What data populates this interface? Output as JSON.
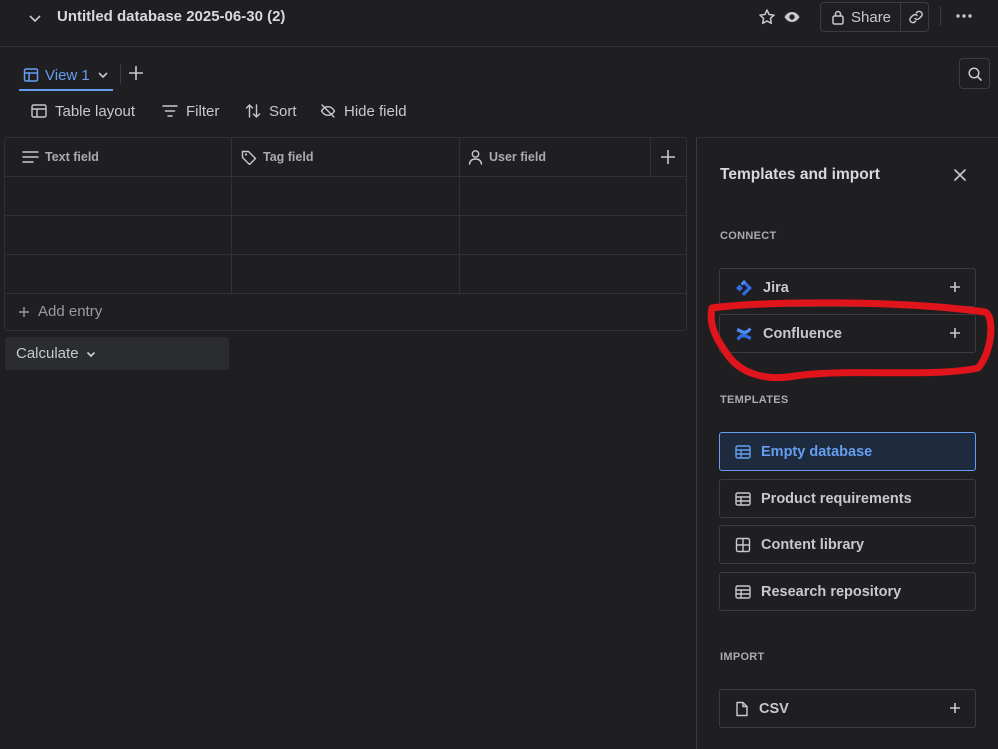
{
  "header": {
    "title": "Untitled database 2025-06-30 (2)",
    "share_label": "Share"
  },
  "views": {
    "active_label": "View 1"
  },
  "toolbar": {
    "layout_label": "Table layout",
    "filter_label": "Filter",
    "sort_label": "Sort",
    "hide_label": "Hide field"
  },
  "table": {
    "columns": [
      {
        "label": "Text field",
        "icon": "text-lines-icon"
      },
      {
        "label": "Tag field",
        "icon": "tag-icon"
      },
      {
        "label": "User field",
        "icon": "user-icon"
      }
    ],
    "add_entry_label": "Add entry",
    "calculate_label": "Calculate"
  },
  "panel": {
    "title": "Templates and import",
    "connect_label": "CONNECT",
    "connect_items": [
      {
        "label": "Jira",
        "icon": "jira-icon"
      },
      {
        "label": "Confluence",
        "icon": "confluence-icon"
      }
    ],
    "templates_label": "TEMPLATES",
    "template_items": [
      {
        "label": "Empty database",
        "icon": "table-icon",
        "selected": true
      },
      {
        "label": "Product requirements",
        "icon": "table-icon"
      },
      {
        "label": "Content library",
        "icon": "grid-icon"
      },
      {
        "label": "Research repository",
        "icon": "table-icon"
      }
    ],
    "import_label": "IMPORT",
    "import_items": [
      {
        "label": "CSV",
        "icon": "file-icon"
      }
    ]
  },
  "colors": {
    "background": "#1f1f21",
    "accent": "#669df1",
    "annotation": "#e0141b",
    "jira": "#2f6fe3"
  }
}
